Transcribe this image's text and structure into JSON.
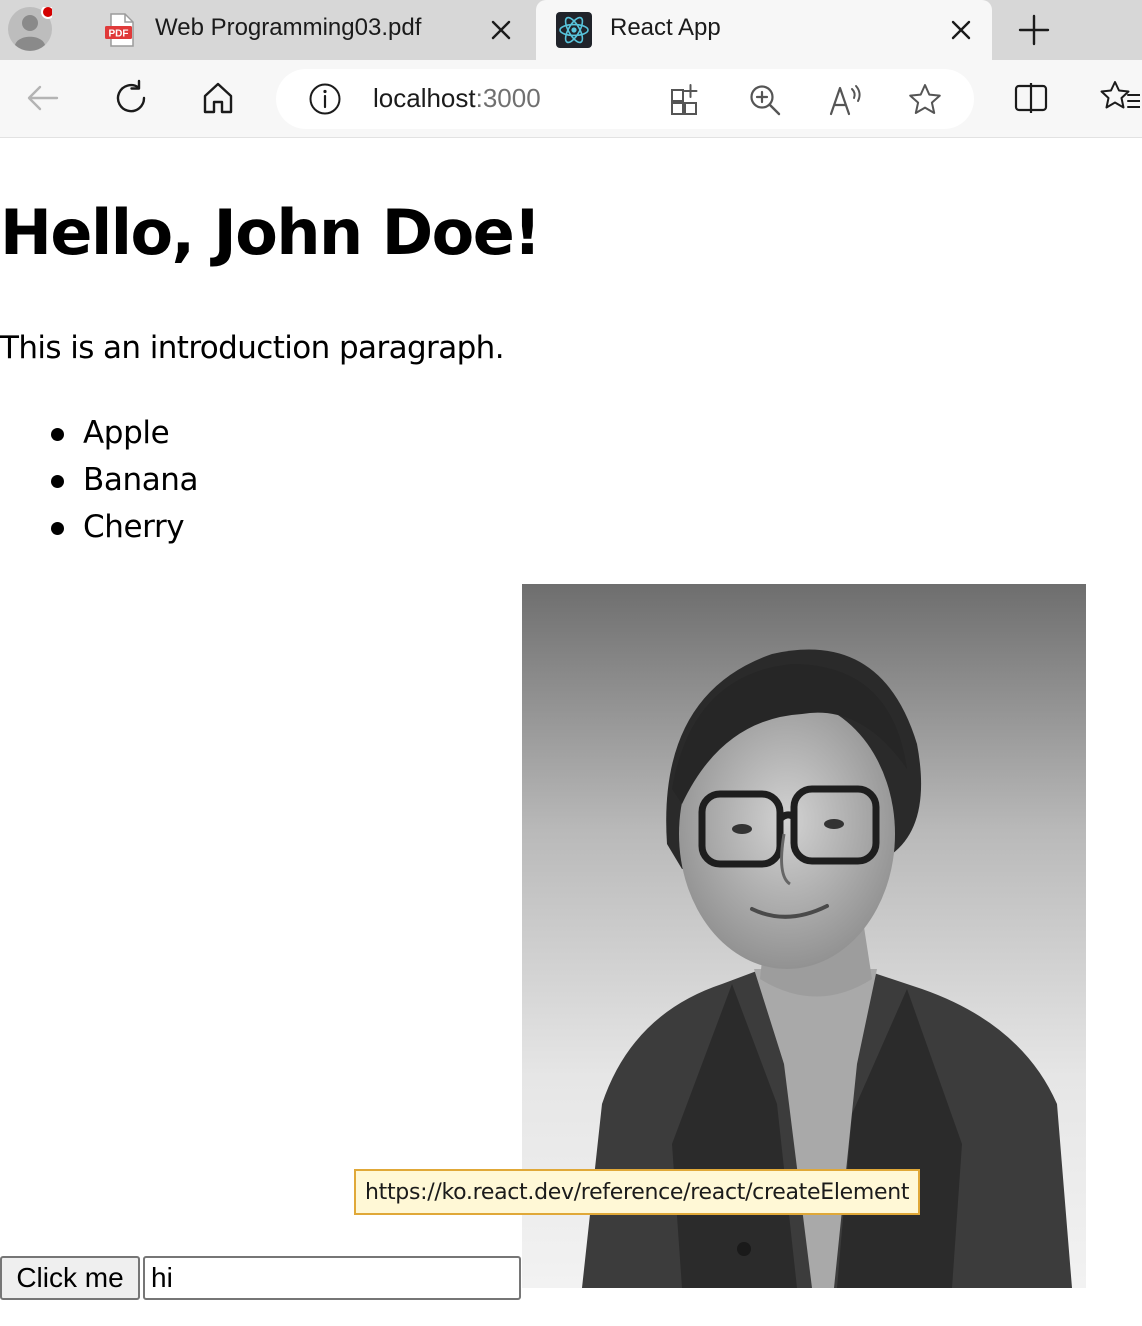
{
  "browser": {
    "tabs": [
      {
        "title": "Web Programming03.pdf",
        "favicon": "pdf-icon",
        "active": false
      },
      {
        "title": "React App",
        "favicon": "react-icon",
        "active": true
      }
    ],
    "address": {
      "host": "localhost",
      "port": ":3000"
    },
    "icons": {
      "profile": "profile-avatar-icon",
      "back": "back-arrow-icon",
      "refresh": "refresh-icon",
      "home": "home-icon",
      "site_info": "info-icon",
      "apps": "add-app-icon",
      "zoom": "zoom-in-icon",
      "read_aloud": "read-aloud-icon",
      "favorite": "star-icon",
      "split_screen": "split-screen-icon",
      "favorites": "favorites-icon",
      "new_tab": "plus-icon",
      "close_tab": "close-icon"
    },
    "colors": {
      "tab_strip": "#d7d7d7",
      "toolbar": "#f7f7f7",
      "profile_badge": "#d40000",
      "pdf_red": "#e03a3a",
      "react_cyan": "#58c4dc"
    }
  },
  "page": {
    "heading": "Hello, John Doe!",
    "intro": "This is an introduction paragraph.",
    "fruits": [
      "Apple",
      "Banana",
      "Cherry"
    ],
    "portrait_alt": "portrait-photo",
    "button_label": "Click me",
    "input_value": "hi",
    "tooltip": "https://ko.react.dev/reference/react/createElement"
  }
}
